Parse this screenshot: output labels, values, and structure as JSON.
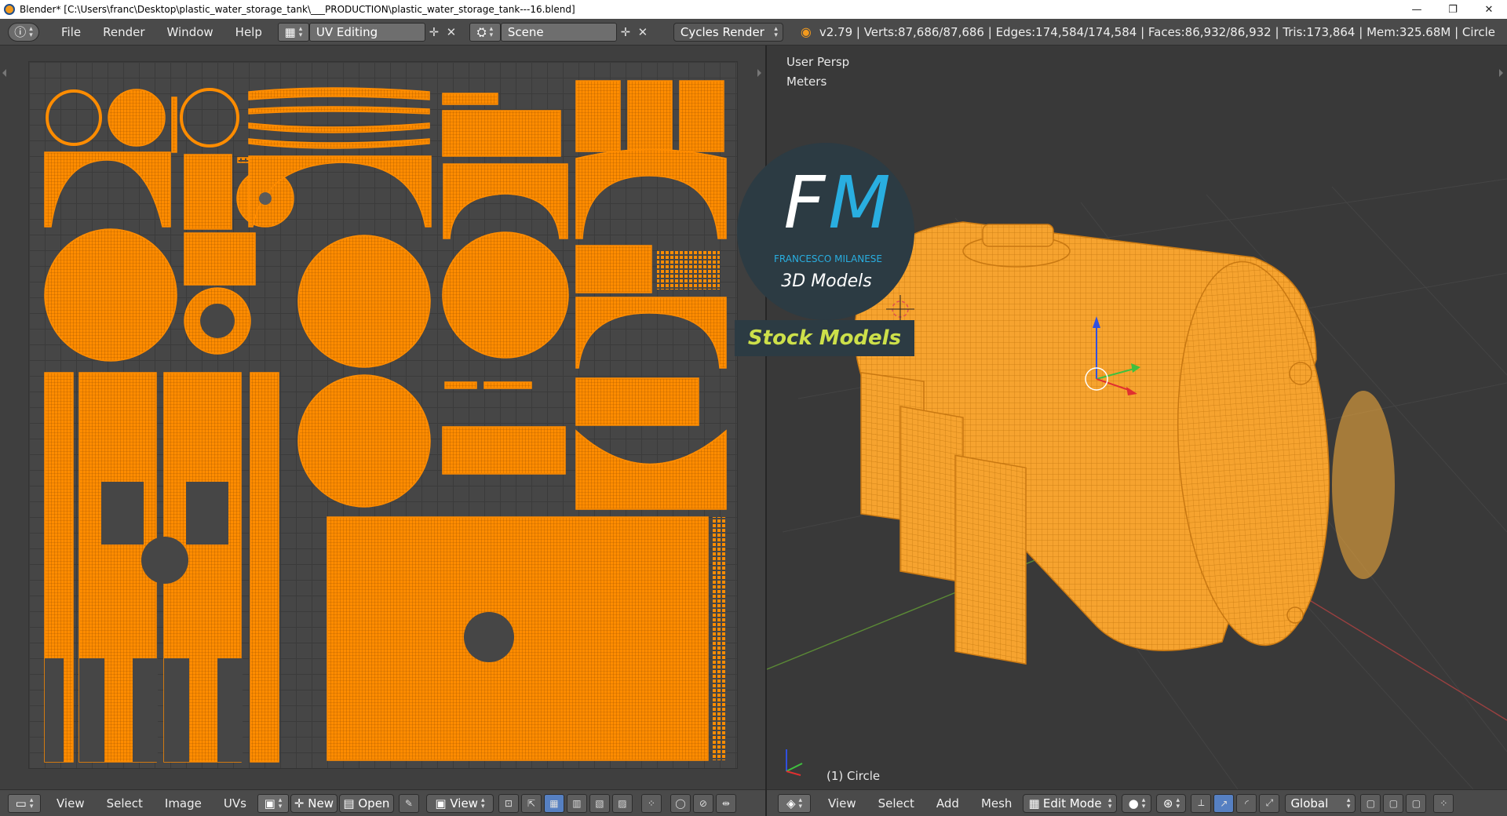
{
  "window": {
    "title": "Blender* [C:\\Users\\franc\\Desktop\\plastic_water_storage_tank\\___PRODUCTION\\plastic_water_storage_tank---16.blend]",
    "minimize": "—",
    "maximize": "❐",
    "close": "✕"
  },
  "header": {
    "menus": [
      "File",
      "Render",
      "Window",
      "Help"
    ],
    "screen_layout": "UV Editing",
    "scene": "Scene",
    "render_engine": "Cycles Render",
    "stats": "v2.79 | Verts:87,686/87,686 | Edges:174,584/174,584 | Faces:86,932/86,932 | Tris:173,864 | Mem:325.68M | Circle"
  },
  "viewport": {
    "view_name": "User Persp",
    "units": "Meters",
    "object_label": "(1) Circle"
  },
  "watermark": {
    "initials_f": "F",
    "initials_m": "M",
    "author": "FRANCESCO MILANESE",
    "tagline": "3D Models",
    "banner": "Stock Models"
  },
  "uv_footer": {
    "view": "View",
    "select": "Select",
    "image": "Image",
    "uvs": "UVs",
    "new": "New",
    "open": "Open",
    "view2": "View"
  },
  "v3d_footer": {
    "view": "View",
    "select": "Select",
    "add": "Add",
    "mesh": "Mesh",
    "mode": "Edit Mode",
    "orientation": "Global"
  },
  "colors": {
    "uv_island": "#ff8c00",
    "mesh_wire": "#f4a636",
    "accent_blue": "#5680c2",
    "fm_cyan": "#29aee0",
    "stock_yellow": "#cde04a"
  }
}
